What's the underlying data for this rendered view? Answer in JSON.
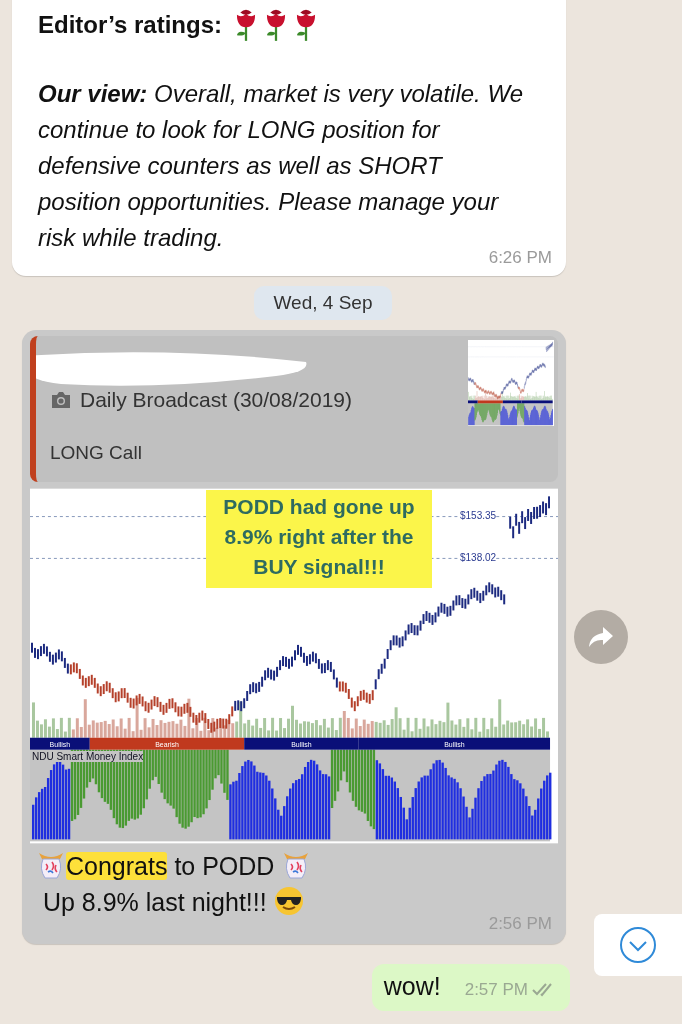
{
  "message_1": {
    "ratings": {
      "label": "Editor’s ratings:",
      "stars": 3
    },
    "text": " **Our view:** Overall, market is very volatile. We continue to look for LONG position for defensive counters as well as SHORT position opportunities. Please manage your risk while trading.",
    "time": "6:26 PM"
  },
  "date_divider": "Wed, 4 Sep",
  "message_2": {
    "quote": {
      "caption": "Daily Broadcast (30/08/2019)",
      "text": "LONG Call"
    },
    "image": {
      "callout": "PODD had gone up 8.9% right after the BUY signal!!!",
      "price_labels": [
        "$153.35",
        "$138.02"
      ],
      "bands": [
        {
          "label": "Bullish",
          "kind": "bullish"
        },
        {
          "label": "Bearish",
          "kind": "bearish"
        },
        {
          "label": "Bullish",
          "kind": "bullish"
        },
        {
          "label": "Bullish",
          "kind": "bullish"
        }
      ],
      "indicator_title": "NDU Smart Money Index"
    },
    "parts": [
      {
        "kind": "confetti"
      },
      {
        "kind": "highlight",
        "text": "Congrats"
      },
      {
        "kind": "text",
        "text": " to PODD "
      },
      {
        "kind": "confetti"
      },
      {
        "kind": "text",
        "text": " Up 8.9% last "
      },
      {
        "kind": "text",
        "text": "night!!! "
      },
      {
        "kind": "cool-face"
      }
    ],
    "time": "2:56 PM"
  },
  "message_3": {
    "text": "wow!",
    "time": "2:57 PM",
    "read": false
  }
}
